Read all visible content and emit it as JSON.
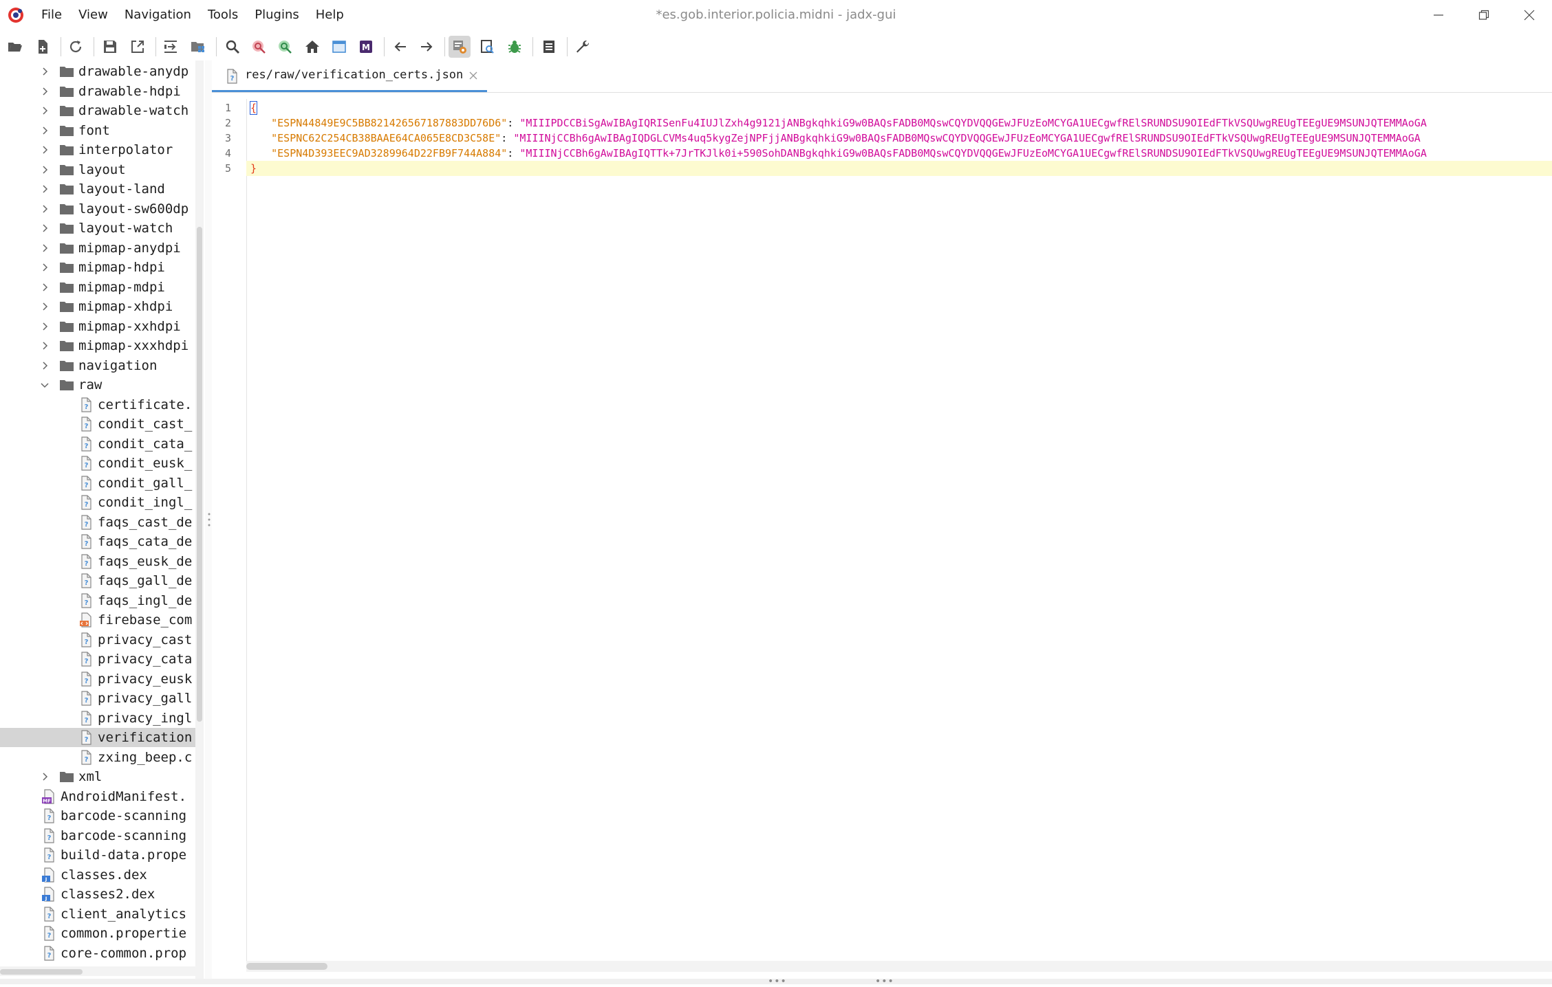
{
  "window": {
    "title": "*es.gob.interior.policia.midni - jadx-gui"
  },
  "menu": [
    "File",
    "View",
    "Navigation",
    "Tools",
    "Plugins",
    "Help"
  ],
  "toolbar": {
    "buttons": [
      "open-file",
      "add-files",
      "reload",
      "save-all",
      "export",
      "sync-with-editor",
      "flatten-packages",
      "search",
      "find-usage",
      "goto-class",
      "home",
      "frame",
      "mapping",
      "back",
      "forward",
      "decompile-mode",
      "deobfuscation",
      "debugger",
      "log",
      "preferences"
    ]
  },
  "tree": {
    "items": [
      {
        "label": "drawable-anydp",
        "kind": "folder",
        "expanded": false,
        "depth": 1
      },
      {
        "label": "drawable-hdpi",
        "kind": "folder",
        "expanded": false,
        "depth": 1
      },
      {
        "label": "drawable-watch",
        "kind": "folder",
        "expanded": false,
        "depth": 1
      },
      {
        "label": "font",
        "kind": "folder",
        "expanded": false,
        "depth": 1
      },
      {
        "label": "interpolator",
        "kind": "folder",
        "expanded": false,
        "depth": 1
      },
      {
        "label": "layout",
        "kind": "folder",
        "expanded": false,
        "depth": 1
      },
      {
        "label": "layout-land",
        "kind": "folder",
        "expanded": false,
        "depth": 1
      },
      {
        "label": "layout-sw600dp",
        "kind": "folder",
        "expanded": false,
        "depth": 1
      },
      {
        "label": "layout-watch",
        "kind": "folder",
        "expanded": false,
        "depth": 1
      },
      {
        "label": "mipmap-anydpi",
        "kind": "folder",
        "expanded": false,
        "depth": 1
      },
      {
        "label": "mipmap-hdpi",
        "kind": "folder",
        "expanded": false,
        "depth": 1
      },
      {
        "label": "mipmap-mdpi",
        "kind": "folder",
        "expanded": false,
        "depth": 1
      },
      {
        "label": "mipmap-xhdpi",
        "kind": "folder",
        "expanded": false,
        "depth": 1
      },
      {
        "label": "mipmap-xxhdpi",
        "kind": "folder",
        "expanded": false,
        "depth": 1
      },
      {
        "label": "mipmap-xxxhdpi",
        "kind": "folder",
        "expanded": false,
        "depth": 1
      },
      {
        "label": "navigation",
        "kind": "folder",
        "expanded": false,
        "depth": 1
      },
      {
        "label": "raw",
        "kind": "folder",
        "expanded": true,
        "depth": 1
      },
      {
        "label": "certificate.",
        "kind": "file",
        "depth": 2
      },
      {
        "label": "condit_cast_",
        "kind": "file",
        "depth": 2
      },
      {
        "label": "condit_cata_",
        "kind": "file",
        "depth": 2
      },
      {
        "label": "condit_eusk_",
        "kind": "file",
        "depth": 2
      },
      {
        "label": "condit_gall_",
        "kind": "file",
        "depth": 2
      },
      {
        "label": "condit_ingl_",
        "kind": "file",
        "depth": 2
      },
      {
        "label": "faqs_cast_de",
        "kind": "file",
        "depth": 2
      },
      {
        "label": "faqs_cata_de",
        "kind": "file",
        "depth": 2
      },
      {
        "label": "faqs_eusk_de",
        "kind": "file",
        "depth": 2
      },
      {
        "label": "faqs_gall_de",
        "kind": "file",
        "depth": 2
      },
      {
        "label": "faqs_ingl_de",
        "kind": "file",
        "depth": 2
      },
      {
        "label": "firebase_com",
        "kind": "xml",
        "depth": 2
      },
      {
        "label": "privacy_cast",
        "kind": "file",
        "depth": 2
      },
      {
        "label": "privacy_cata",
        "kind": "file",
        "depth": 2
      },
      {
        "label": "privacy_eusk",
        "kind": "file",
        "depth": 2
      },
      {
        "label": "privacy_gall",
        "kind": "file",
        "depth": 2
      },
      {
        "label": "privacy_ingl",
        "kind": "file",
        "depth": 2
      },
      {
        "label": "verification",
        "kind": "file",
        "depth": 2,
        "selected": true
      },
      {
        "label": "zxing_beep.c",
        "kind": "file",
        "depth": 2
      },
      {
        "label": "xml",
        "kind": "folder",
        "expanded": false,
        "depth": 1
      },
      {
        "label": "AndroidManifest.",
        "kind": "manifest",
        "depth": 0
      },
      {
        "label": "barcode-scanning",
        "kind": "file",
        "depth": 0
      },
      {
        "label": "barcode-scanning",
        "kind": "file",
        "depth": 0
      },
      {
        "label": "build-data.prope",
        "kind": "file",
        "depth": 0
      },
      {
        "label": "classes.dex",
        "kind": "dex",
        "depth": 0
      },
      {
        "label": "classes2.dex",
        "kind": "dex",
        "depth": 0
      },
      {
        "label": "client_analytics",
        "kind": "file",
        "depth": 0
      },
      {
        "label": "common.propertie",
        "kind": "file",
        "depth": 0
      },
      {
        "label": "core-common.prop",
        "kind": "file",
        "depth": 0
      }
    ]
  },
  "editor": {
    "tab_label": "res/raw/verification_certs.json",
    "lines": [
      {
        "num": "1",
        "brace": "{"
      },
      {
        "num": "2",
        "key": "\"ESPN44849E9C5BB821426567187883DD76D6\"",
        "sep": ": ",
        "val": "\"MIIIPDCCBiSgAwIBAgIQRISenFu4IUJlZxh4g9121jANBgkqhkiG9w0BAQsFADB0MQswCQYDVQQGEwJFUzEoMCYGA1UECgwfRElSRUNDSU9OIEdFTkVSQUwgREUgTEEgUE9MSUNJQTEMMAoGA"
      },
      {
        "num": "3",
        "key": "\"ESPNC62C254CB38BAAE64CA065E8CD3C58E\"",
        "sep": ": ",
        "val": "\"MIIINjCCBh6gAwIBAgIQDGLCVMs4uq5kygZejNPFjjANBgkqhkiG9w0BAQsFADB0MQswCQYDVQQGEwJFUzEoMCYGA1UECgwfRElSRUNDSU9OIEdFTkVSQUwgREUgTEEgUE9MSUNJQTEMMAoGA"
      },
      {
        "num": "4",
        "key": "\"ESPN4D393EEC9AD3289964D22FB9F744A884\"",
        "sep": ": ",
        "val": "\"MIIINjCCBh6gAwIBAgIQTTk+7JrTKJlk0i+590SohDANBgkqhkiG9w0BAQsFADB0MQswCQYDVQQGEwJFUzEoMCYGA1UECgwfRElSRUNDSU9OIEdFTkVSQUwgREUgTEEgUE9MSUNJQTEMMAoGA"
      },
      {
        "num": "5",
        "brace": "}"
      }
    ]
  },
  "colors": {
    "brace": "#e33c1a",
    "key": "#d77a00",
    "value": "#d10c9a",
    "current_line": "#fdfbd0",
    "tab_underline": "#4a8fd6",
    "selection": "#d5d5d5"
  }
}
